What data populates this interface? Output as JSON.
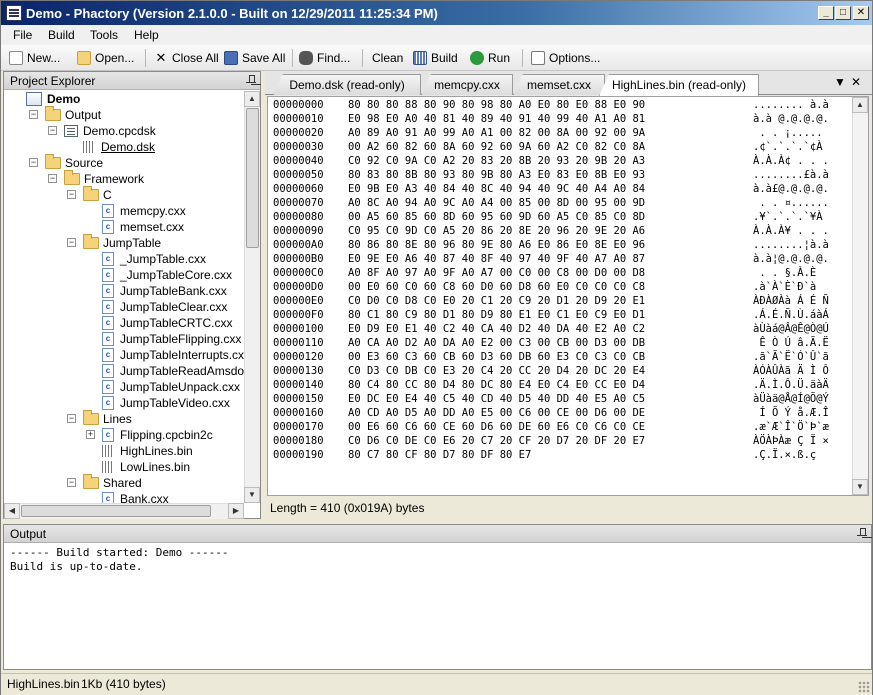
{
  "window": {
    "title": "Demo - Phactory (Version 2.1.0.0 - Built on 12/29/2011 11:25:34 PM)"
  },
  "window_controls": {
    "minimize": "_",
    "maximize": "□",
    "close": "✕"
  },
  "menu": [
    "File",
    "Build",
    "Tools",
    "Help"
  ],
  "toolbar": {
    "new": "New...",
    "open": "Open...",
    "close_all": "Close All",
    "save_all": "Save All",
    "find": "Find...",
    "clean": "Clean",
    "build": "Build",
    "run": "Run",
    "options": "Options..."
  },
  "explorer": {
    "title": "Project Explorer",
    "tree": [
      {
        "label": "Demo",
        "level": 0,
        "type": "project",
        "bold": true
      },
      {
        "label": "Output",
        "level": 1,
        "type": "folder",
        "exp": "-"
      },
      {
        "label": "Demo.cpcdsk",
        "level": 2,
        "type": "dsk",
        "exp": "-"
      },
      {
        "label": "Demo.dsk",
        "level": 3,
        "type": "bin",
        "underline": true
      },
      {
        "label": "Source",
        "level": 1,
        "type": "folder",
        "exp": "-"
      },
      {
        "label": "Framework",
        "level": 2,
        "type": "folder",
        "exp": "-"
      },
      {
        "label": "C",
        "level": 3,
        "type": "folder",
        "exp": "-"
      },
      {
        "label": "memcpy.cxx",
        "level": 4,
        "type": "cfile"
      },
      {
        "label": "memset.cxx",
        "level": 4,
        "type": "cfile"
      },
      {
        "label": "JumpTable",
        "level": 3,
        "type": "folder",
        "exp": "-"
      },
      {
        "label": "_JumpTable.cxx",
        "level": 4,
        "type": "cfile"
      },
      {
        "label": "_JumpTableCore.cxx",
        "level": 4,
        "type": "cfile"
      },
      {
        "label": "JumpTableBank.cxx",
        "level": 4,
        "type": "cfile"
      },
      {
        "label": "JumpTableClear.cxx",
        "level": 4,
        "type": "cfile"
      },
      {
        "label": "JumpTableCRTC.cxx",
        "level": 4,
        "type": "cfile"
      },
      {
        "label": "JumpTableFlipping.cxx",
        "level": 4,
        "type": "cfile"
      },
      {
        "label": "JumpTableInterrupts.cxx",
        "level": 4,
        "type": "cfile"
      },
      {
        "label": "JumpTableReadAmsdos.cxx",
        "level": 4,
        "type": "cfile"
      },
      {
        "label": "JumpTableUnpack.cxx",
        "level": 4,
        "type": "cfile"
      },
      {
        "label": "JumpTableVideo.cxx",
        "level": 4,
        "type": "cfile"
      },
      {
        "label": "Lines",
        "level": 3,
        "type": "folder",
        "exp": "-"
      },
      {
        "label": "Flipping.cpcbin2c",
        "level": 4,
        "type": "cfile",
        "exp": "+"
      },
      {
        "label": "HighLines.bin",
        "level": 4,
        "type": "bin"
      },
      {
        "label": "LowLines.bin",
        "level": 4,
        "type": "bin"
      },
      {
        "label": "Shared",
        "level": 3,
        "type": "folder",
        "exp": "-"
      },
      {
        "label": "Bank.cxx",
        "level": 4,
        "type": "cfile"
      }
    ]
  },
  "tabs": [
    {
      "label": "Demo.dsk (read-only)",
      "active": false
    },
    {
      "label": "memcpy.cxx",
      "active": false
    },
    {
      "label": "memset.cxx",
      "active": false
    },
    {
      "label": "HighLines.bin (read-only)",
      "active": true
    }
  ],
  "tab_controls": {
    "dropdown": "▼",
    "close": "✕"
  },
  "hex_rows": [
    {
      "addr": "00000000",
      "bytes": "80 80 80 88 80 90 80 98 80 A0 E0 80 E0 88 E0 90",
      "ascii": "........ à.à"
    },
    {
      "addr": "00000010",
      "bytes": "E0 98 E0 A0 40 81 40 89 40 91 40 99 40 A1 A0 81",
      "ascii": "à.à @.@.@.@."
    },
    {
      "addr": "00000020",
      "bytes": "A0 89 A0 91 A0 99 A0 A1 00 82 00 8A 00 92 00 9A",
      "ascii": " . . ¡....."
    },
    {
      "addr": "00000030",
      "bytes": "00 A2 60 82 60 8A 60 92 60 9A 60 A2 C0 82 C0 8A",
      "ascii": ".¢`.`.`.`¢À"
    },
    {
      "addr": "00000040",
      "bytes": "C0 92 C0 9A C0 A2 20 83 20 8B 20 93 20 9B 20 A3",
      "ascii": "À.À.À¢ . . ."
    },
    {
      "addr": "00000050",
      "bytes": "80 83 80 8B 80 93 80 9B 80 A3 E0 83 E0 8B E0 93",
      "ascii": "........£à.à"
    },
    {
      "addr": "00000060",
      "bytes": "E0 9B E0 A3 40 84 40 8C 40 94 40 9C 40 A4 A0 84",
      "ascii": "à.à£@.@.@.@."
    },
    {
      "addr": "00000070",
      "bytes": "A0 8C A0 94 A0 9C A0 A4 00 85 00 8D 00 95 00 9D",
      "ascii": " . . ¤......"
    },
    {
      "addr": "00000080",
      "bytes": "00 A5 60 85 60 8D 60 95 60 9D 60 A5 C0 85 C0 8D",
      "ascii": ".¥`.`.`.`¥À"
    },
    {
      "addr": "00000090",
      "bytes": "C0 95 C0 9D C0 A5 20 86 20 8E 20 96 20 9E 20 A6",
      "ascii": "À.À.À¥ . . ."
    },
    {
      "addr": "000000A0",
      "bytes": "80 86 80 8E 80 96 80 9E 80 A6 E0 86 E0 8E E0 96",
      "ascii": "........¦à.à"
    },
    {
      "addr": "000000B0",
      "bytes": "E0 9E E0 A6 40 87 40 8F 40 97 40 9F 40 A7 A0 87",
      "ascii": "à.à¦@.@.@.@."
    },
    {
      "addr": "000000C0",
      "bytes": "A0 8F A0 97 A0 9F A0 A7 00 C0 00 C8 00 D0 00 D8",
      "ascii": " . . §.À.È"
    },
    {
      "addr": "000000D0",
      "bytes": "00 E0 60 C0 60 C8 60 D0 60 D8 60 E0 C0 C0 C0 C8",
      "ascii": ".à`À`È`Ð`à"
    },
    {
      "addr": "000000E0",
      "bytes": "C0 D0 C0 D8 C0 E0 20 C1 20 C9 20 D1 20 D9 20 E1",
      "ascii": "ÀÐÀØÀà Á É Ñ"
    },
    {
      "addr": "000000F0",
      "bytes": "80 C1 80 C9 80 D1 80 D9 80 E1 E0 C1 E0 C9 E0 D1",
      "ascii": ".Á.É.Ñ.Ù.áàÁ"
    },
    {
      "addr": "00000100",
      "bytes": "E0 D9 E0 E1 40 C2 40 CA 40 D2 40 DA 40 E2 A0 C2",
      "ascii": "àÙàá@Â@Ê@Ò@Ú"
    },
    {
      "addr": "00000110",
      "bytes": "A0 CA A0 D2 A0 DA A0 E2 00 C3 00 CB 00 D3 00 DB",
      "ascii": " Ê Ò Ú â.Ã.Ë"
    },
    {
      "addr": "00000120",
      "bytes": "00 E3 60 C3 60 CB 60 D3 60 DB 60 E3 C0 C3 C0 CB",
      "ascii": ".ã`Ã`Ë`Ó`Û`ã"
    },
    {
      "addr": "00000130",
      "bytes": "C0 D3 C0 DB C0 E3 20 C4 20 CC 20 D4 20 DC 20 E4",
      "ascii": "ÀÓÀÛÀã Ä Ì Ô"
    },
    {
      "addr": "00000140",
      "bytes": "80 C4 80 CC 80 D4 80 DC 80 E4 E0 C4 E0 CC E0 D4",
      "ascii": ".Ä.Ì.Ô.Ü.äàÄ"
    },
    {
      "addr": "00000150",
      "bytes": "E0 DC E0 E4 40 C5 40 CD 40 D5 40 DD 40 E5 A0 C5",
      "ascii": "àÜàä@Å@Í@Õ@Ý"
    },
    {
      "addr": "00000160",
      "bytes": "A0 CD A0 D5 A0 DD A0 E5 00 C6 00 CE 00 D6 00 DE",
      "ascii": " Í Õ Ý å.Æ.Î"
    },
    {
      "addr": "00000170",
      "bytes": "00 E6 60 C6 60 CE 60 D6 60 DE 60 E6 C0 C6 C0 CE",
      "ascii": ".æ`Æ`Î`Ö`Þ`æ"
    },
    {
      "addr": "00000180",
      "bytes": "C0 D6 C0 DE C0 E6 20 C7 20 CF 20 D7 20 DF 20 E7",
      "ascii": "ÀÖÀÞÀæ Ç Ï ×"
    },
    {
      "addr": "00000190",
      "bytes": "80 C7 80 CF 80 D7 80 DF 80 E7",
      "ascii": ".Ç.Ï.×.ß.ç"
    }
  ],
  "editor_status": "Length = 410 (0x019A) bytes",
  "output": {
    "title": "Output",
    "lines": [
      "------ Build started: Demo ------",
      "Build is up-to-date."
    ]
  },
  "status_bar": {
    "file": "HighLines.bin",
    "size": "1Kb (410 bytes)"
  }
}
